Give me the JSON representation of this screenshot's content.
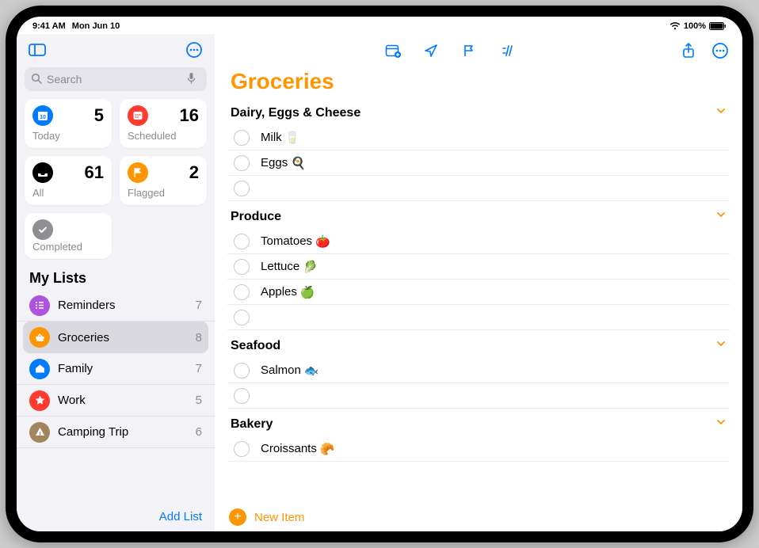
{
  "status": {
    "time": "9:41 AM",
    "date": "Mon Jun 10",
    "battery": "100%"
  },
  "search": {
    "placeholder": "Search"
  },
  "tiles": {
    "today": {
      "label": "Today",
      "count": "5",
      "color": "#007aff"
    },
    "scheduled": {
      "label": "Scheduled",
      "count": "16",
      "color": "#ff3b30"
    },
    "all": {
      "label": "All",
      "count": "61",
      "color": "#000000"
    },
    "flagged": {
      "label": "Flagged",
      "count": "2",
      "color": "#ff9500"
    },
    "completed": {
      "label": "Completed",
      "color": "#8e8e93"
    }
  },
  "lists_header": "My Lists",
  "lists": [
    {
      "name": "Reminders",
      "count": "7",
      "color": "#af52de",
      "icon": "list",
      "selected": false
    },
    {
      "name": "Groceries",
      "count": "8",
      "color": "#ff9500",
      "icon": "basket",
      "selected": true
    },
    {
      "name": "Family",
      "count": "7",
      "color": "#007aff",
      "icon": "house",
      "selected": false
    },
    {
      "name": "Work",
      "count": "5",
      "color": "#ff3b30",
      "icon": "star",
      "selected": false
    },
    {
      "name": "Camping Trip",
      "count": "6",
      "color": "#a2845e",
      "icon": "tent",
      "selected": false
    }
  ],
  "add_list_label": "Add List",
  "main": {
    "title": "Groceries",
    "title_color": "#ff9500",
    "new_item_label": "New Item",
    "sections": [
      {
        "name": "Dairy, Eggs & Cheese",
        "items": [
          {
            "text": "Milk",
            "emoji": "🥛"
          },
          {
            "text": "Eggs",
            "emoji": "🍳"
          },
          {
            "text": "",
            "emoji": ""
          }
        ]
      },
      {
        "name": "Produce",
        "items": [
          {
            "text": "Tomatoes",
            "emoji": "🍅"
          },
          {
            "text": "Lettuce",
            "emoji": "🥬"
          },
          {
            "text": "Apples",
            "emoji": "🍏"
          },
          {
            "text": "",
            "emoji": ""
          }
        ]
      },
      {
        "name": "Seafood",
        "items": [
          {
            "text": "Salmon",
            "emoji": "🐟"
          },
          {
            "text": "",
            "emoji": ""
          }
        ]
      },
      {
        "name": "Bakery",
        "items": [
          {
            "text": "Croissants",
            "emoji": "🥐"
          }
        ]
      }
    ]
  }
}
